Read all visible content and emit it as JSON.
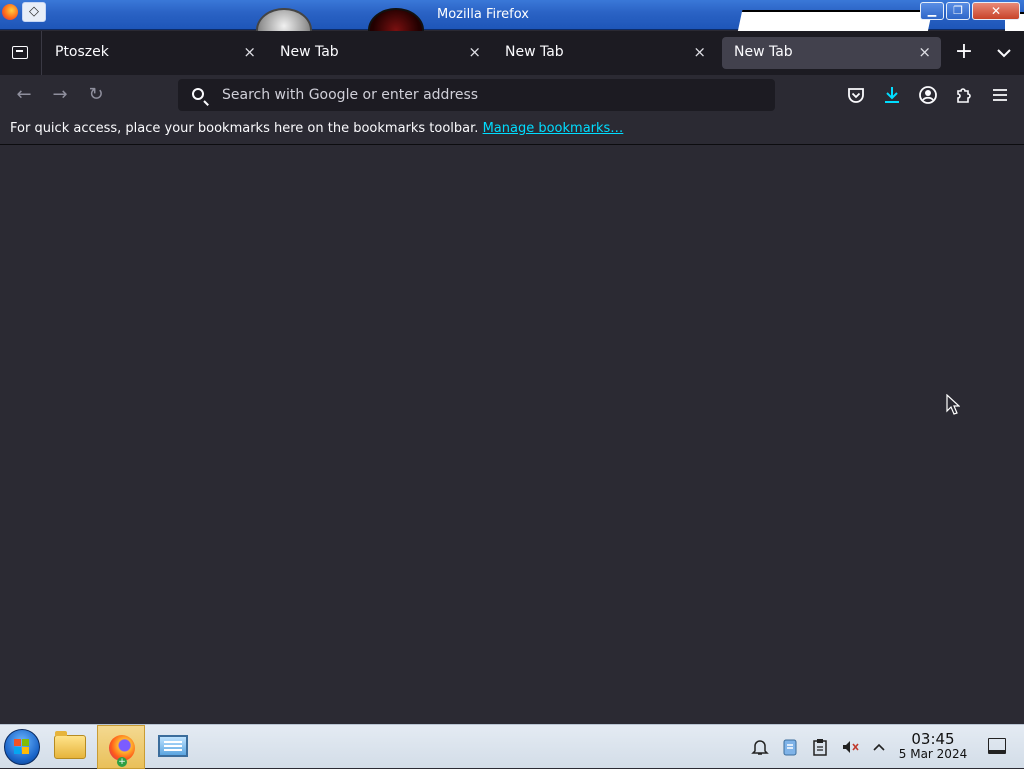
{
  "window": {
    "title": "Mozilla Firefox",
    "controls": {
      "minimize": "▁",
      "maximize": "❐",
      "close": "✕"
    },
    "sysmenu_icon": "◇"
  },
  "tabs": [
    {
      "label": "Ptoszek",
      "close": "×",
      "active": false
    },
    {
      "label": "New Tab",
      "close": "×",
      "active": false
    },
    {
      "label": "New Tab",
      "close": "×",
      "active": false
    },
    {
      "label": "New Tab",
      "close": "×",
      "active": true
    }
  ],
  "tabbar": {
    "new_tab_icon": "+",
    "list_all_tabs_icon": "⌄"
  },
  "navbar": {
    "back_icon": "←",
    "forward_icon": "→",
    "reload_icon": "↻",
    "address_placeholder": "Search with Google or enter address",
    "address_value": ""
  },
  "bookmarks_toolbar": {
    "message": "For quick access, place your bookmarks here on the bookmarks toolbar.",
    "link": "Manage bookmarks…"
  },
  "taskbar": {
    "apps": [
      "file-manager",
      "firefox",
      "system-monitor"
    ],
    "tray_icons": [
      "notifications-icon",
      "klipper-icon",
      "clipboard-icon",
      "volume-muted-icon",
      "expand-tray-icon"
    ],
    "clock": {
      "time": "03:45",
      "date": "5 Mar 2024"
    }
  },
  "colors": {
    "accent": "#00ddff",
    "toolbar_bg": "#2b2a33",
    "tabbar_bg": "#1c1b22",
    "active_tab": "#42414d",
    "download_icon": "#00ddff"
  }
}
